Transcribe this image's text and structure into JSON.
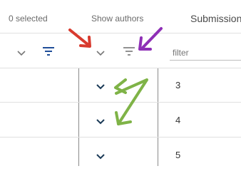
{
  "header": {
    "selected_count": "0 selected",
    "show_authors": "Show authors",
    "submission_label": "Submission"
  },
  "filter_row": {
    "placeholder": "filter",
    "value": ""
  },
  "rows": [
    {
      "number": "3"
    },
    {
      "number": "4"
    },
    {
      "number": "5"
    }
  ],
  "icons": {
    "chevron": "chevron-down-icon",
    "filter": "filter-icon",
    "arrow": "annotation-arrow-icon"
  },
  "colors": {
    "filter_icon_active": "#1f4e99",
    "filter_icon_muted": "#777777",
    "chevron_dark": "#1b3a57",
    "annotation_red": "#d83a2e",
    "annotation_purple": "#8e2fb6",
    "annotation_green": "#7fb347"
  }
}
